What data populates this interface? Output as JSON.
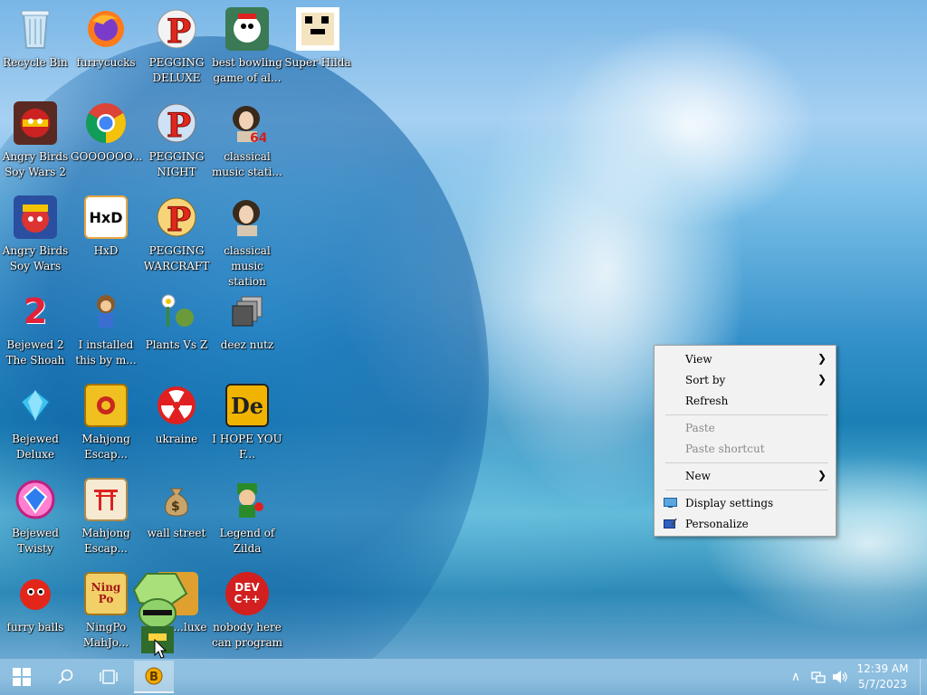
{
  "desktop": {
    "icons": [
      {
        "label": "Recycle Bin",
        "icon": "recycle-bin-icon"
      },
      {
        "label": "furrycucks",
        "icon": "firefox-icon"
      },
      {
        "label": "PEGGING DELUXE",
        "icon": "peggle-icon"
      },
      {
        "label": "best bowling game of al...",
        "icon": "bowling-game-icon"
      },
      {
        "label": "Super Hilda",
        "icon": "super-hilda-icon"
      },
      {
        "label": "Angry Birds Soy Wars 2",
        "icon": "angry-birds-star-wars-icon"
      },
      {
        "label": "GOOOOOO...",
        "icon": "chrome-icon"
      },
      {
        "label": "PEGGING NIGHT",
        "icon": "peggle-nights-icon"
      },
      {
        "label": "classical music stati...",
        "icon": "classical-portrait-icon"
      },
      {
        "label": "Angry Birds Soy Wars",
        "icon": "angry-birds-star-wars-icon"
      },
      {
        "label": "HxD",
        "icon": "hxd-icon"
      },
      {
        "label": "PEGGING WARCRAFT",
        "icon": "peggle-icon"
      },
      {
        "label": "classical music station",
        "icon": "classical-portrait-icon"
      },
      {
        "label": "Bejewed 2 The Shoah",
        "icon": "bejeweled-2-icon"
      },
      {
        "label": "I installed this by m...",
        "icon": "monkey-icon"
      },
      {
        "label": "Plants Vs Z",
        "icon": "plants-vs-zombies-icon"
      },
      {
        "label": "deez nutz",
        "icon": "stacked-windows-icon"
      },
      {
        "label": "Bejewed Deluxe",
        "icon": "gem-icon"
      },
      {
        "label": "Mahjong Escap...",
        "icon": "mahjong-tile-icon"
      },
      {
        "label": "ukraine",
        "icon": "radiation-icon"
      },
      {
        "label": "I HOPE YOU F...",
        "icon": "de-icon"
      },
      {
        "label": "Bejewed Twisty",
        "icon": "bejeweled-twist-icon"
      },
      {
        "label": "Mahjong Escap...",
        "icon": "torii-gate-icon"
      },
      {
        "label": "wall street",
        "icon": "money-bag-icon"
      },
      {
        "label": "Legend of Zilda",
        "icon": "zelda-icon"
      },
      {
        "label": "furry balls",
        "icon": "red-fluffy-ball-icon"
      },
      {
        "label": "NingPo MahJo...",
        "icon": "ningpo-icon"
      },
      {
        "label": "...luxe",
        "icon": "game-icon"
      },
      {
        "label": "nobody here can program",
        "icon": "dev-cpp-icon"
      }
    ],
    "ningpo_icon_text": "Ning Po",
    "hxd_icon_text": "HxD",
    "de_icon_text": "De",
    "devcpp_icon_text": "DEV C++",
    "bejeweled2_icon_text": "2"
  },
  "context_menu": {
    "items": [
      {
        "label": "View",
        "submenu": true,
        "enabled": true
      },
      {
        "label": "Sort by",
        "submenu": true,
        "enabled": true
      },
      {
        "label": "Refresh",
        "submenu": false,
        "enabled": true
      },
      {
        "label": "Paste",
        "submenu": false,
        "enabled": false
      },
      {
        "label": "Paste shortcut",
        "submenu": false,
        "enabled": false
      },
      {
        "label": "New",
        "submenu": true,
        "enabled": true
      },
      {
        "label": "Display settings",
        "submenu": false,
        "enabled": true,
        "icon": "display-icon"
      },
      {
        "label": "Personalize",
        "submenu": false,
        "enabled": true,
        "icon": "personalize-icon"
      }
    ],
    "submenu_arrow": "❯"
  },
  "taskbar": {
    "start_icon": "windows-logo-icon",
    "search_icon": "search-icon",
    "task_view_icon": "task-view-icon",
    "pinned_app_icon": "bitcoin-app-icon",
    "tray": {
      "chevron": "∧",
      "network_icon": "network-icon",
      "volume_icon": "volume-icon"
    },
    "clock": {
      "time": "12:39 AM",
      "date": "5/7/2023"
    }
  },
  "colors": {
    "taskbar": "#8ebfdf",
    "menu_bg": "#f2f2f2",
    "disabled_text": "#8a8a8a"
  }
}
